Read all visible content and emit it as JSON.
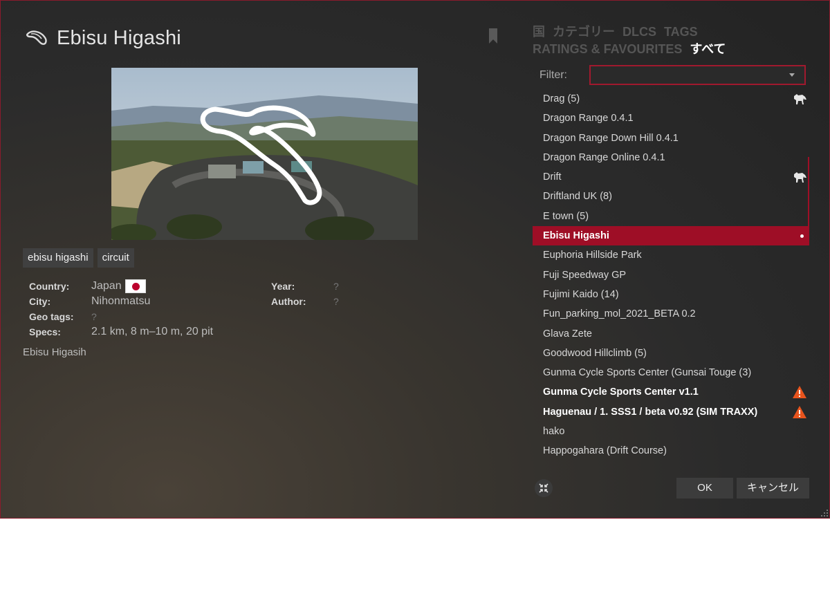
{
  "window": {
    "title": "Ebisu Higashi"
  },
  "tags": [
    "ebisu higashi",
    "circuit"
  ],
  "details": {
    "country_label": "Country:",
    "country_value": "Japan",
    "city_label": "City:",
    "city_value": "Nihonmatsu",
    "geo_label": "Geo tags:",
    "geo_value": "?",
    "specs_label": "Specs:",
    "specs_value": "2.1 km, 8 m–10 m, 20 pit",
    "year_label": "Year:",
    "year_value": "?",
    "author_label": "Author:",
    "author_value": "?"
  },
  "description": "Ebisu Higasih",
  "categories": [
    "国",
    "カテゴリー",
    "DLCS",
    "TAGS",
    "RATINGS & FAVOURITES",
    "すべて"
  ],
  "active_category": "すべて",
  "filter": {
    "label": "Filter:",
    "value": ""
  },
  "list": [
    {
      "label": "Drag (5)",
      "icon": "horse-icon"
    },
    {
      "label": "Dragon Range 0.4.1"
    },
    {
      "label": "Dragon Range Down Hill 0.4.1"
    },
    {
      "label": "Dragon Range Online 0.4.1"
    },
    {
      "label": "Drift",
      "icon": "horse-icon"
    },
    {
      "label": "Driftland UK (8)"
    },
    {
      "label": "E town (5)"
    },
    {
      "label": "Ebisu Higashi",
      "selected": true
    },
    {
      "label": "Euphoria Hillside Park"
    },
    {
      "label": "Fuji Speedway GP"
    },
    {
      "label": "Fujimi Kaido (14)"
    },
    {
      "label": "Fun_parking_mol_2021_BETA 0.2"
    },
    {
      "label": "Glava Zete"
    },
    {
      "label": "Goodwood Hillclimb (5)"
    },
    {
      "label": "Gunma Cycle Sports Center (Gunsai Touge (3)"
    },
    {
      "label": "Gunma Cycle Sports Center v1.1",
      "bold": true,
      "icon": "warning-icon"
    },
    {
      "label": "Haguenau / 1. SSS1 / beta v0.92 (SIM TRAXX)",
      "bold": true,
      "icon": "warning-icon"
    },
    {
      "label": "hako"
    },
    {
      "label": "Happogahara (Drift Course)"
    }
  ],
  "buttons": {
    "ok": "OK",
    "cancel": "キャンセル"
  },
  "colors": {
    "accent": "#9e0e26",
    "warning": "#e8541d"
  }
}
